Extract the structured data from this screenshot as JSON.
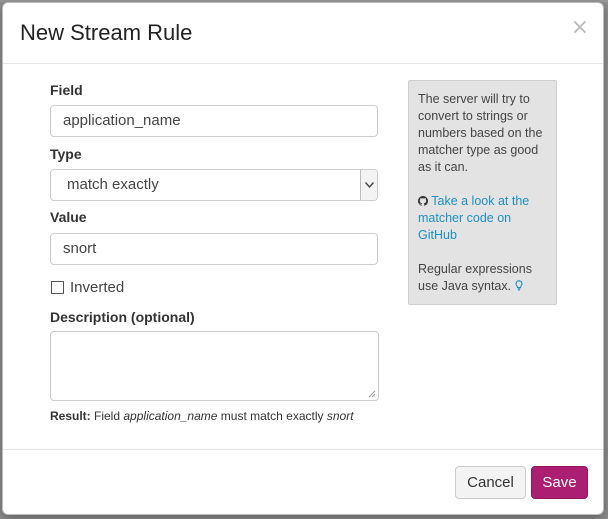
{
  "modal": {
    "title": "New Stream Rule",
    "close_glyph": "×"
  },
  "form": {
    "field_label": "Field",
    "field_value": "application_name",
    "type_label": "Type",
    "type_selected": "match exactly",
    "value_label": "Value",
    "value_value": "snort",
    "inverted_label": "Inverted",
    "inverted_checked": false,
    "description_label": "Description (optional)",
    "description_value": "",
    "result": {
      "prefix": "Result:",
      "text1": "Field",
      "field": "application_name",
      "text2": "must match exactly",
      "value": "snort"
    }
  },
  "help": {
    "paragraph1": "The server will try to convert to strings or numbers based on the matcher type as good as it can.",
    "link_text": "Take a look at the matcher code on GitHub",
    "paragraph3": "Regular expressions use Java syntax.",
    "github_icon": "github-icon",
    "lightbulb_icon": "lightbulb-icon"
  },
  "footer": {
    "cancel_label": "Cancel",
    "save_label": "Save"
  },
  "colors": {
    "save_button": "#ab1e72",
    "link": "#1d8fc1",
    "help_bg": "#e3e3e3"
  }
}
